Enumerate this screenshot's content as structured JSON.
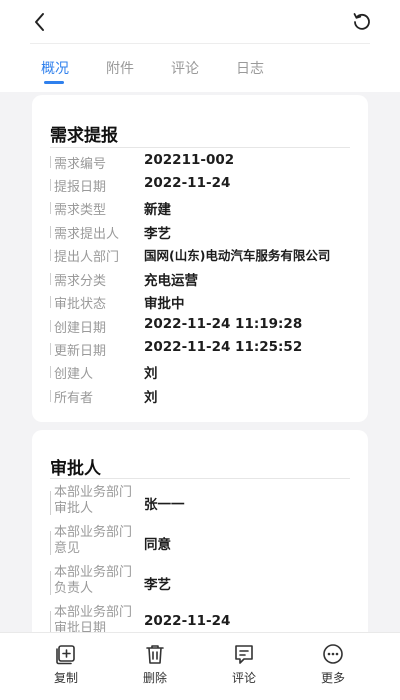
{
  "tabs": [
    {
      "label": "概况",
      "active": true
    },
    {
      "label": "附件",
      "active": false
    },
    {
      "label": "评论",
      "active": false
    },
    {
      "label": "日志",
      "active": false
    }
  ],
  "card1": {
    "title": "需求提报",
    "rows": [
      {
        "label": "需求编号",
        "value": "202211-002"
      },
      {
        "label": "提报日期",
        "value": "2022-11-24"
      },
      {
        "label": "需求类型",
        "value": "新建"
      },
      {
        "label": "需求提出人",
        "value": "李艺"
      },
      {
        "label": "提出人部门",
        "value": "国网(山东)电动汽车服务有限公司"
      },
      {
        "label": "需求分类",
        "value": "充电运营"
      },
      {
        "label": "审批状态",
        "value": "审批中"
      },
      {
        "label": "创建日期",
        "value": "2022-11-24 11:19:28"
      },
      {
        "label": "更新日期",
        "value": "2022-11-24 11:25:52"
      },
      {
        "label": "创建人",
        "value": "刘"
      },
      {
        "label": "所有者",
        "value": "刘"
      }
    ]
  },
  "card2": {
    "title": "审批人",
    "rows": [
      {
        "label": "本部业务部门审批人",
        "value": "张一一"
      },
      {
        "label": "本部业务部门意见",
        "value": "同意"
      },
      {
        "label": "本部业务部门负责人",
        "value": "李艺"
      },
      {
        "label": "本部业务部门审批日期",
        "value": "2022-11-24"
      }
    ]
  },
  "actions": [
    {
      "label": "复制",
      "icon": "copy-add-icon"
    },
    {
      "label": "删除",
      "icon": "trash-icon"
    },
    {
      "label": "评论",
      "icon": "comment-icon"
    },
    {
      "label": "更多",
      "icon": "more-icon"
    }
  ],
  "colors": {
    "accent": "#2f80ed",
    "label": "#9a9a9a",
    "value": "#1d1d1d",
    "background": "#f3f3f5"
  }
}
